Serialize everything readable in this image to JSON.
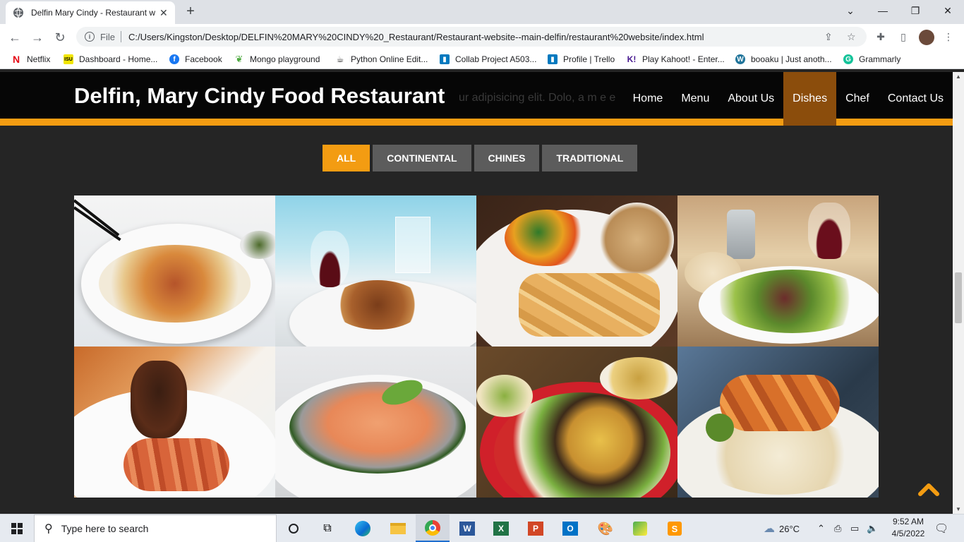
{
  "browser": {
    "tab_title": "Delfin Mary Cindy - Restaurant w",
    "new_tab_symbol": "+",
    "scheme": "File",
    "url": "C:/Users/Kingston/Desktop/DELFIN%20MARY%20CINDY%20_Restaurant/Restaurant-website--main-delfin/restaurant%20website/index.html",
    "bookmarks": [
      {
        "label": "Netflix",
        "icon": "netflix-icon",
        "color": "#e50914"
      },
      {
        "label": "Dashboard - Home...",
        "icon": "dashboard-icon",
        "color": "#f2e600"
      },
      {
        "label": "Facebook",
        "icon": "facebook-icon",
        "color": "#1877f2"
      },
      {
        "label": "Mongo playground",
        "icon": "mongo-icon",
        "color": "#4faa41"
      },
      {
        "label": "Python Online Edit...",
        "icon": "python-icon",
        "color": "#333333"
      },
      {
        "label": "Collab Project A503...",
        "icon": "trello-icon",
        "color": "#0079bf"
      },
      {
        "label": "Profile | Trello",
        "icon": "trello-icon",
        "color": "#0079bf"
      },
      {
        "label": "Play Kahoot! - Enter...",
        "icon": "kahoot-icon",
        "color": "#46178f"
      },
      {
        "label": "booaku | Just anoth...",
        "icon": "wordpress-icon",
        "color": "#21759b"
      },
      {
        "label": "Grammarly",
        "icon": "grammarly-icon",
        "color": "#15c39a"
      }
    ]
  },
  "site": {
    "brand": "Delfin, Mary Cindy Food Restaurant",
    "ghost_text": "ur adipisicing elit. Dolo, a      m e        e",
    "nav": [
      {
        "label": "Home",
        "active": false
      },
      {
        "label": "Menu",
        "active": false
      },
      {
        "label": "About Us",
        "active": false
      },
      {
        "label": "Dishes",
        "active": true
      },
      {
        "label": "Chef",
        "active": false
      },
      {
        "label": "Contact Us",
        "active": false
      }
    ],
    "filters": [
      {
        "label": "ALL",
        "active": true
      },
      {
        "label": "CONTINENTAL",
        "active": false
      },
      {
        "label": "CHINES",
        "active": false
      },
      {
        "label": "TRADITIONAL",
        "active": false
      }
    ],
    "dishes": [
      {
        "name": "shrimp-noodles"
      },
      {
        "name": "roast-quail"
      },
      {
        "name": "pot-pie-fries"
      },
      {
        "name": "green-salad"
      },
      {
        "name": "steak-lobster"
      },
      {
        "name": "salmon-steak"
      },
      {
        "name": "mexican-platter"
      },
      {
        "name": "shrimp-rice"
      }
    ],
    "accent_color": "#f39c12"
  },
  "taskbar": {
    "search_placeholder": "Type here to search",
    "weather": "26°C",
    "time": "9:52 AM",
    "date": "4/5/2022"
  }
}
